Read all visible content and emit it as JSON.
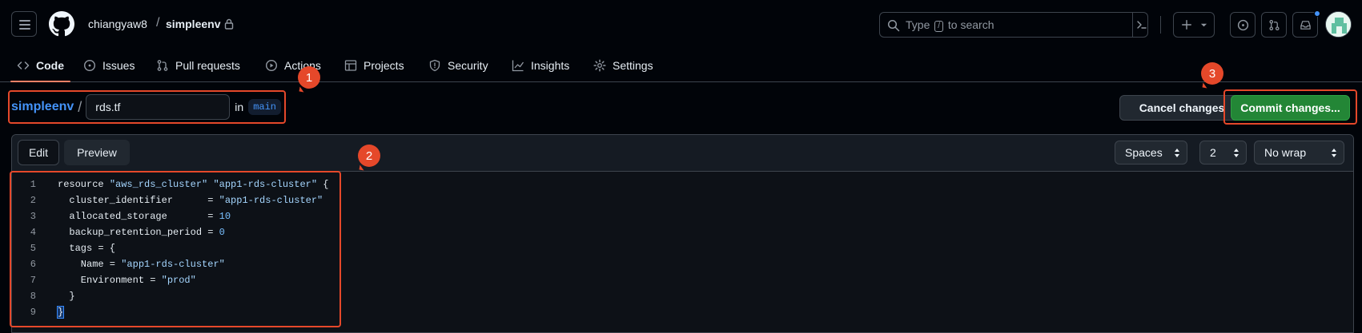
{
  "header": {
    "owner": "chiangyaw8",
    "separator": "/",
    "repo": "simpleenv",
    "search_placeholder_pre": "Type",
    "search_key": "/",
    "search_placeholder_post": "to search"
  },
  "nav": {
    "items": [
      {
        "label": "Code",
        "icon": "code-icon"
      },
      {
        "label": "Issues",
        "icon": "issue-icon"
      },
      {
        "label": "Pull requests",
        "icon": "pull-request-icon"
      },
      {
        "label": "Actions",
        "icon": "play-icon"
      },
      {
        "label": "Projects",
        "icon": "table-icon"
      },
      {
        "label": "Security",
        "icon": "shield-icon"
      },
      {
        "label": "Insights",
        "icon": "graph-icon"
      },
      {
        "label": "Settings",
        "icon": "gear-icon"
      }
    ]
  },
  "path": {
    "repo_link": "simpleenv",
    "separator": "/",
    "filename": "rds.tf",
    "in_label": "in",
    "branch": "main"
  },
  "actions": {
    "cancel_label": "Cancel changes",
    "commit_label": "Commit changes..."
  },
  "editor": {
    "tab_edit": "Edit",
    "tab_preview": "Preview",
    "indent_mode": "Spaces",
    "indent_size": "2",
    "wrap_mode": "No wrap",
    "lines": [
      {
        "num": "1",
        "parts": [
          [
            "t",
            "resource "
          ],
          [
            "s",
            "\"aws_rds_cluster\""
          ],
          [
            "t",
            " "
          ],
          [
            "s",
            "\"app1-rds-cluster\""
          ],
          [
            "t",
            " {"
          ]
        ]
      },
      {
        "num": "2",
        "parts": [
          [
            "t",
            "  cluster_identifier      = "
          ],
          [
            "s",
            "\"app1-rds-cluster\""
          ]
        ]
      },
      {
        "num": "3",
        "parts": [
          [
            "t",
            "  allocated_storage       = "
          ],
          [
            "n",
            "10"
          ]
        ]
      },
      {
        "num": "4",
        "parts": [
          [
            "t",
            "  backup_retention_period = "
          ],
          [
            "n",
            "0"
          ]
        ]
      },
      {
        "num": "5",
        "parts": [
          [
            "t",
            "  tags = {"
          ]
        ]
      },
      {
        "num": "6",
        "parts": [
          [
            "t",
            "    Name = "
          ],
          [
            "s",
            "\"app1-rds-cluster\""
          ]
        ]
      },
      {
        "num": "7",
        "parts": [
          [
            "t",
            "    Environment = "
          ],
          [
            "s",
            "\"prod\""
          ]
        ]
      },
      {
        "num": "8",
        "parts": [
          [
            "t",
            "  }"
          ]
        ]
      },
      {
        "num": "9",
        "parts": [
          [
            "b",
            "}"
          ]
        ]
      }
    ]
  },
  "annotations": [
    "1",
    "2",
    "3"
  ],
  "colors": {
    "accent_link": "#4493f8",
    "commit_green": "#238636",
    "annotation_red": "#e5482a",
    "nav_underline": "#f78166"
  }
}
